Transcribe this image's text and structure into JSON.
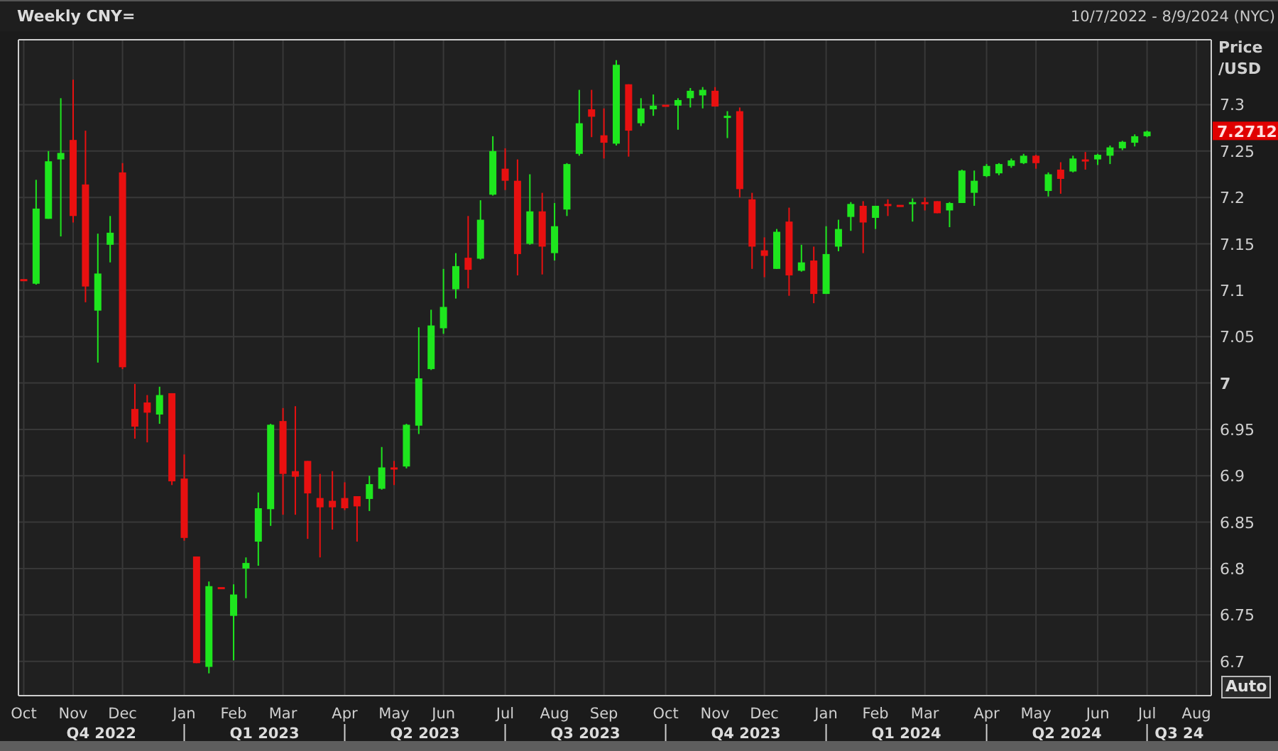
{
  "header": {
    "title": "Weekly CNY=",
    "date_range": "10/7/2022 - 8/9/2024 (NYC)"
  },
  "chart": {
    "price_badge": "7.2712",
    "auto_button": "Auto",
    "quarters": [
      "Q4 2022",
      "Q1 2023",
      "Q2 2023",
      "Q3 2023",
      "Q4 2023",
      "Q1 2024",
      "Q2 2024",
      "Q3 24"
    ],
    "chart_data": {
      "type": "candlestick",
      "ylabel": "Price /USD",
      "grid": true,
      "ylim": [
        6.663,
        7.37
      ],
      "yticks": [
        6.7,
        6.75,
        6.8,
        6.85,
        6.9,
        6.95,
        7,
        7.05,
        7.1,
        7.15,
        7.2,
        7.25,
        7.3
      ],
      "categories": [
        "Oct",
        null,
        null,
        null,
        "Nov",
        null,
        null,
        null,
        "Dec",
        null,
        null,
        null,
        null,
        "Jan",
        null,
        null,
        null,
        "Feb",
        null,
        null,
        null,
        "Mar",
        null,
        null,
        null,
        null,
        "Apr",
        null,
        null,
        null,
        "May",
        null,
        null,
        null,
        "Jun",
        null,
        null,
        null,
        null,
        "Jul",
        null,
        null,
        null,
        "Aug",
        null,
        null,
        null,
        "Sep",
        null,
        null,
        null,
        null,
        "Oct",
        null,
        null,
        null,
        "Nov",
        null,
        null,
        null,
        "Dec",
        null,
        null,
        null,
        null,
        "Jan",
        null,
        null,
        null,
        "Feb",
        null,
        null,
        null,
        "Mar",
        null,
        null,
        null,
        null,
        "Apr",
        null,
        null,
        null,
        "May",
        null,
        null,
        null,
        null,
        "Jun",
        null,
        null,
        null,
        "Jul",
        null,
        null,
        null,
        "Aug"
      ],
      "ohlc": [
        [
          7.112,
          7.112,
          7.112,
          7.112
        ],
        [
          7.107,
          7.219,
          7.106,
          7.188
        ],
        [
          7.177,
          7.25,
          7.177,
          7.239
        ],
        [
          7.241,
          7.307,
          7.158,
          7.248
        ],
        [
          7.262,
          7.327,
          7.173,
          7.18
        ],
        [
          7.214,
          7.272,
          7.087,
          7.104
        ],
        [
          7.078,
          7.161,
          7.022,
          7.118
        ],
        [
          7.149,
          7.18,
          7.13,
          7.162
        ],
        [
          7.227,
          7.237,
          7.015,
          7.017
        ],
        [
          6.972,
          6.999,
          6.94,
          6.953
        ],
        [
          6.979,
          6.987,
          6.936,
          6.968
        ],
        [
          6.966,
          6.996,
          6.956,
          6.987
        ],
        [
          6.989,
          6.989,
          6.89,
          6.894
        ],
        [
          6.897,
          6.923,
          6.83,
          6.833
        ],
        [
          6.813,
          6.813,
          6.698,
          6.698
        ],
        [
          6.694,
          6.786,
          6.687,
          6.781
        ],
        [
          6.78,
          6.78,
          6.78,
          6.78
        ],
        [
          6.749,
          6.783,
          6.701,
          6.772
        ],
        [
          6.8,
          6.812,
          6.768,
          6.806
        ],
        [
          6.829,
          6.882,
          6.803,
          6.865
        ],
        [
          6.864,
          6.956,
          6.846,
          6.955
        ],
        [
          6.959,
          6.973,
          6.858,
          6.902
        ],
        [
          6.905,
          6.975,
          6.858,
          6.899
        ],
        [
          6.916,
          6.916,
          6.832,
          6.881
        ],
        [
          6.876,
          6.902,
          6.812,
          6.866
        ],
        [
          6.873,
          6.905,
          6.842,
          6.866
        ],
        [
          6.876,
          6.893,
          6.863,
          6.865
        ],
        [
          6.878,
          6.878,
          6.829,
          6.867
        ],
        [
          6.875,
          6.9,
          6.862,
          6.891
        ],
        [
          6.886,
          6.931,
          6.885,
          6.909
        ],
        [
          6.909,
          6.916,
          6.89,
          6.909
        ],
        [
          6.91,
          6.956,
          6.908,
          6.955
        ],
        [
          6.954,
          7.06,
          6.945,
          7.005
        ],
        [
          7.015,
          7.079,
          7.014,
          7.062
        ],
        [
          7.059,
          7.123,
          7.053,
          7.082
        ],
        [
          7.101,
          7.14,
          7.091,
          7.126
        ],
        [
          7.135,
          7.18,
          7.102,
          7.122
        ],
        [
          7.134,
          7.197,
          7.133,
          7.176
        ],
        [
          7.203,
          7.266,
          7.202,
          7.25
        ],
        [
          7.231,
          7.253,
          7.208,
          7.218
        ],
        [
          7.218,
          7.241,
          7.116,
          7.139
        ],
        [
          7.15,
          7.225,
          7.149,
          7.185
        ],
        [
          7.185,
          7.205,
          7.117,
          7.147
        ],
        [
          7.14,
          7.194,
          7.132,
          7.169
        ],
        [
          7.187,
          7.237,
          7.18,
          7.236
        ],
        [
          7.247,
          7.316,
          7.245,
          7.28
        ],
        [
          7.295,
          7.316,
          7.265,
          7.287
        ],
        [
          7.267,
          7.296,
          7.242,
          7.259
        ],
        [
          7.258,
          7.348,
          7.256,
          7.343
        ],
        [
          7.322,
          7.322,
          7.244,
          7.272
        ],
        [
          7.28,
          7.307,
          7.277,
          7.296
        ],
        [
          7.295,
          7.311,
          7.288,
          7.299
        ],
        [
          7.3,
          7.3,
          7.3,
          7.3
        ],
        [
          7.299,
          7.307,
          7.273,
          7.305
        ],
        [
          7.307,
          7.318,
          7.297,
          7.315
        ],
        [
          7.31,
          7.319,
          7.296,
          7.316
        ],
        [
          7.315,
          7.319,
          7.298,
          7.298
        ],
        [
          7.286,
          7.293,
          7.264,
          7.288
        ],
        [
          7.293,
          7.297,
          7.2,
          7.209
        ],
        [
          7.198,
          7.205,
          7.123,
          7.147
        ],
        [
          7.143,
          7.157,
          7.114,
          7.137
        ],
        [
          7.123,
          7.166,
          7.123,
          7.163
        ],
        [
          7.174,
          7.189,
          7.094,
          7.116
        ],
        [
          7.121,
          7.149,
          7.12,
          7.13
        ],
        [
          7.132,
          7.147,
          7.086,
          7.096
        ],
        [
          7.096,
          7.169,
          7.096,
          7.139
        ],
        [
          7.147,
          7.176,
          7.142,
          7.166
        ],
        [
          7.179,
          7.195,
          7.164,
          7.193
        ],
        [
          7.191,
          7.196,
          7.14,
          7.173
        ],
        [
          7.178,
          7.191,
          7.166,
          7.191
        ],
        [
          7.193,
          7.198,
          7.18,
          7.193
        ],
        [
          7.192,
          7.192,
          7.192,
          7.192
        ],
        [
          7.193,
          7.199,
          7.174,
          7.195
        ],
        [
          7.195,
          7.2,
          7.186,
          7.195
        ],
        [
          7.196,
          7.196,
          7.183,
          7.183
        ],
        [
          7.186,
          7.195,
          7.168,
          7.194
        ],
        [
          7.194,
          7.23,
          7.194,
          7.229
        ],
        [
          7.205,
          7.229,
          7.191,
          7.218
        ],
        [
          7.223,
          7.236,
          7.222,
          7.234
        ],
        [
          7.226,
          7.237,
          7.224,
          7.236
        ],
        [
          7.234,
          7.242,
          7.232,
          7.24
        ],
        [
          7.237,
          7.247,
          7.236,
          7.245
        ],
        [
          7.245,
          7.246,
          7.231,
          7.237
        ],
        [
          7.207,
          7.227,
          7.201,
          7.225
        ],
        [
          7.23,
          7.238,
          7.204,
          7.22
        ],
        [
          7.228,
          7.245,
          7.227,
          7.242
        ],
        [
          7.241,
          7.249,
          7.23,
          7.241
        ],
        [
          7.241,
          7.247,
          7.235,
          7.246
        ],
        [
          7.245,
          7.256,
          7.236,
          7.254
        ],
        [
          7.253,
          7.261,
          7.251,
          7.26
        ],
        [
          7.259,
          7.268,
          7.255,
          7.266
        ],
        [
          7.266,
          7.272,
          7.265,
          7.271
        ],
        null,
        null,
        null,
        null
      ]
    }
  }
}
